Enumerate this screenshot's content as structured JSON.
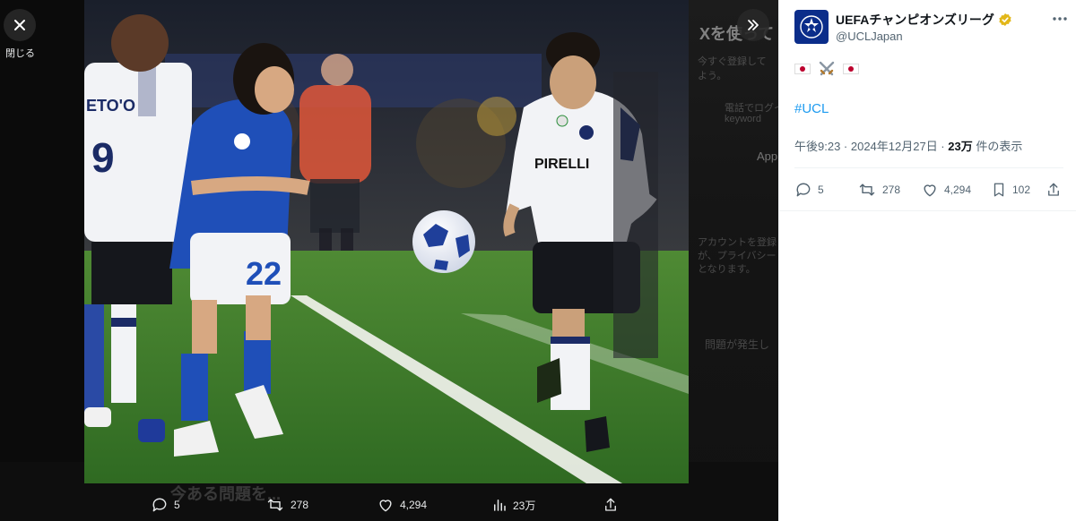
{
  "viewer": {
    "close_label": "閉じる",
    "ghost_title": "Xを使って",
    "ghost_line1": "今すぐ登録して",
    "ghost_line2": "よう。",
    "ghost_line3": "電話でログイ",
    "ghost_line4": "keyword",
    "ghost_app": "App",
    "ghost_line5": "アカウントを登録",
    "ghost_line6": "が、プライバシー",
    "ghost_line7": "となります。",
    "ghost_error": "問題が発生し",
    "ghost_bottom": "今ある問題を...",
    "actions": {
      "replies": "5",
      "retweets": "278",
      "likes": "4,294",
      "views": "23万"
    }
  },
  "photo": {
    "player_left_name": "ETO'O",
    "player_left_number": "9",
    "player_mid_number": "22",
    "sponsor": "PIRELLI"
  },
  "tweet": {
    "display_name": "UEFAチャンピオンズリーグ",
    "handle": "@UCLJapan",
    "hashtag": "#UCL",
    "time": "午後9:23 · 2024年12月27日 · ",
    "views_count": "23万",
    "views_suffix": " 件の表示",
    "replies": "5",
    "retweets": "278",
    "likes": "4,294",
    "bookmarks": "102"
  },
  "colors": {
    "accent": "#1d9bf0",
    "verified": "#e2b719",
    "pitch": "#3c7a2a",
    "schalke_blue": "#1f4fb8"
  }
}
